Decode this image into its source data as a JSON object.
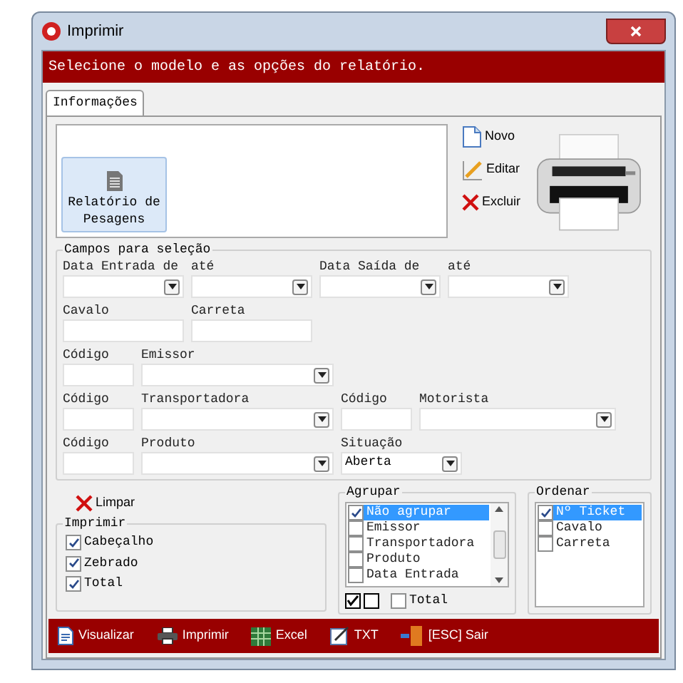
{
  "window": {
    "title": "Imprimir"
  },
  "header": "Selecione o modelo e as opções do relatório.",
  "tabs": [
    {
      "label": "Informações",
      "selected": true
    }
  ],
  "models": [
    {
      "label": "Relatório de Pesagens",
      "selected": true
    }
  ],
  "model_actions": [
    {
      "label": "Novo",
      "kind": "new"
    },
    {
      "label": "Editar",
      "kind": "edit"
    },
    {
      "label": "Excluir",
      "kind": "delete"
    }
  ],
  "selection": {
    "title": "Campos para seleção",
    "rows": [
      [
        {
          "label": "Data Entrada de",
          "kind": "combo"
        },
        {
          "label": "até",
          "kind": "combo"
        },
        {
          "label": "Data Saída de",
          "kind": "combo"
        },
        {
          "label": "até",
          "kind": "combo"
        }
      ],
      [
        {
          "label": "Cavalo",
          "kind": "text"
        },
        {
          "label": "Carreta",
          "kind": "text"
        }
      ],
      [
        {
          "label": "Código",
          "kind": "text"
        },
        {
          "label": "Emissor",
          "kind": "combo"
        }
      ],
      [
        {
          "label": "Código",
          "kind": "text"
        },
        {
          "label": "Transportadora",
          "kind": "combo"
        },
        {
          "label": "Código",
          "kind": "text"
        },
        {
          "label": "Motorista",
          "kind": "combo"
        }
      ],
      [
        {
          "label": "Código",
          "kind": "text"
        },
        {
          "label": "Produto",
          "kind": "combo"
        },
        {
          "label": "Situação",
          "kind": "combo",
          "value": "Aberta"
        }
      ]
    ]
  },
  "clear_button": "Limpar",
  "print_options": {
    "title": "Imprimir",
    "items": [
      {
        "label": "Cabeçalho",
        "checked": true
      },
      {
        "label": "Zebrado",
        "checked": true
      },
      {
        "label": "Total",
        "checked": true
      }
    ]
  },
  "group_by": {
    "title": "Agrupar",
    "items": [
      {
        "label": "Não agrupar",
        "checked": true,
        "selected": true
      },
      {
        "label": "Emissor",
        "checked": false,
        "selected": false
      },
      {
        "label": "Transportadora",
        "checked": false,
        "selected": false
      },
      {
        "label": "Produto",
        "checked": false,
        "selected": false
      },
      {
        "label": "Data Entrada",
        "checked": false,
        "selected": false
      }
    ],
    "total": {
      "label": "Total",
      "checked": false
    }
  },
  "order_by": {
    "title": "Ordenar",
    "items": [
      {
        "label": "Nº Ticket",
        "checked": true,
        "selected": true
      },
      {
        "label": "Cavalo",
        "checked": false,
        "selected": false
      },
      {
        "label": "Carreta",
        "checked": false,
        "selected": false
      }
    ]
  },
  "footer_buttons": [
    {
      "label": "Visualizar",
      "kind": "preview"
    },
    {
      "label": "Imprimir",
      "kind": "print"
    },
    {
      "label": "Excel",
      "kind": "excel"
    },
    {
      "label": "TXT",
      "kind": "txt"
    },
    {
      "label": "[ESC] Sair",
      "kind": "exit"
    }
  ]
}
